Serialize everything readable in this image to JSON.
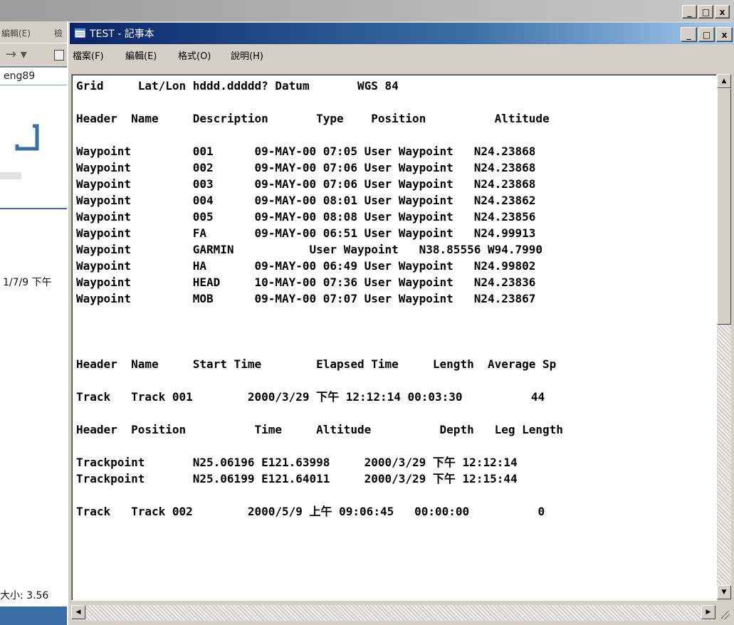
{
  "background_window": {
    "menu_items": [
      "編輯(E)",
      "檢"
    ],
    "address_text": "eng89",
    "date_text": "1/7/9 下午",
    "size_text": "大小: 3.56"
  },
  "notepad": {
    "title": "TEST - 記事本",
    "menu": [
      "檔案(F)",
      "編輯(E)",
      "格式(O)",
      "說明(H)"
    ],
    "lines": [
      "Grid     Lat/Lon hddd.ddddd? Datum       WGS 84",
      "",
      "Header  Name     Description       Type    Position          Altitude",
      "",
      "Waypoint         001      09-MAY-00 07:05 User Waypoint   N24.23868",
      "Waypoint         002      09-MAY-00 07:06 User Waypoint   N24.23868",
      "Waypoint         003      09-MAY-00 07:06 User Waypoint   N24.23868",
      "Waypoint         004      09-MAY-00 08:01 User Waypoint   N24.23862",
      "Waypoint         005      09-MAY-00 08:08 User Waypoint   N24.23856",
      "Waypoint         FA       09-MAY-00 06:51 User Waypoint   N24.99913",
      "Waypoint         GARMIN           User Waypoint   N38.85556 W94.7990",
      "Waypoint         HA       09-MAY-00 06:49 User Waypoint   N24.99802",
      "Waypoint         HEAD     10-MAY-00 07:36 User Waypoint   N24.23836",
      "Waypoint         MOB      09-MAY-00 07:07 User Waypoint   N24.23867",
      "",
      "",
      "",
      "Header  Name     Start Time        Elapsed Time     Length  Average Sp",
      "",
      "Track   Track 001        2000/3/29 下午 12:12:14 00:03:30          44",
      "",
      "Header  Position          Time     Altitude          Depth   Leg Length",
      "",
      "Trackpoint       N25.06196 E121.63998     2000/3/29 下午 12:12:14",
      "Trackpoint       N25.06199 E121.64011     2000/3/29 下午 12:15:44",
      "",
      "Track   Track 002        2000/5/9 上午 09:06:45   00:00:00          0"
    ]
  },
  "controls": {
    "minimize": "_",
    "maximize": "□",
    "close": "x",
    "scroll_up": "▲",
    "scroll_down": "▼",
    "scroll_left": "◀",
    "scroll_right": "▶"
  },
  "icons": {
    "app": "notepad-icon",
    "nav": "forward-arrow-icon"
  }
}
